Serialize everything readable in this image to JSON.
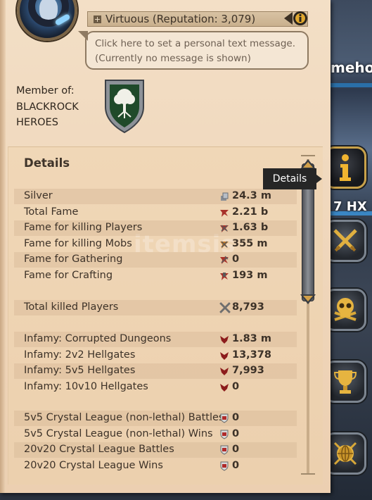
{
  "header": {
    "reputation_text": "Virtuous (Reputation: 3,079)",
    "personal_message_line1": "Click here to set a personal text message.",
    "personal_message_line2": "(Currently no message is shown)"
  },
  "guild": {
    "member_label": "Member of:",
    "name_line1": "BLACKROCK",
    "name_line2": "HEROES"
  },
  "details": {
    "title": "Details",
    "tooltip": "Details",
    "rows": [
      {
        "label": "Silver",
        "value": "24.3 m",
        "icon": "silver-icon"
      },
      {
        "label": "Total Fame",
        "value": "2.21 b",
        "icon": "fame-icon"
      },
      {
        "label": "Fame for killing Players",
        "value": "1.63 b",
        "icon": "pvp-fame-icon"
      },
      {
        "label": "Fame for killing Mobs",
        "value": "355 m",
        "icon": "pve-fame-icon"
      },
      {
        "label": "Fame for Gathering",
        "value": "0",
        "icon": "gathering-fame-icon"
      },
      {
        "label": "Fame for Crafting",
        "value": "193 m",
        "icon": "crafting-fame-icon"
      },
      {
        "label": "Total killed Players",
        "value": "8,793",
        "icon": "crossed-swords-icon"
      },
      {
        "label": "Infamy: Corrupted Dungeons",
        "value": "1.83 m",
        "icon": "infamy-icon"
      },
      {
        "label": "Infamy: 2v2 Hellgates",
        "value": "13,378",
        "icon": "infamy-icon"
      },
      {
        "label": "Infamy: 5v5 Hellgates",
        "value": "7,993",
        "icon": "infamy-icon"
      },
      {
        "label": "Infamy: 10v10 Hellgates",
        "value": "0",
        "icon": "infamy-icon"
      },
      {
        "label": "5v5 Crystal League (non-lethal) Battles",
        "value": "0",
        "icon": "crystal-league-icon"
      },
      {
        "label": "5v5 Crystal League (non-lethal) Wins",
        "value": "0",
        "icon": "crystal-league-icon"
      },
      {
        "label": "20v20 Crystal League Battles",
        "value": "0",
        "icon": "crystal-league-icon"
      },
      {
        "label": "20v20 Crystal League Wins",
        "value": "0",
        "icon": "crystal-league-icon"
      }
    ]
  },
  "scene": {
    "name_fragment": "meho",
    "tag_fragment": "7 HX"
  },
  "watermark": "itemsis",
  "colors": {
    "parchment": "#f0d8bd",
    "accent_gold": "#d2a04a",
    "fame_red": "#a8322a"
  }
}
